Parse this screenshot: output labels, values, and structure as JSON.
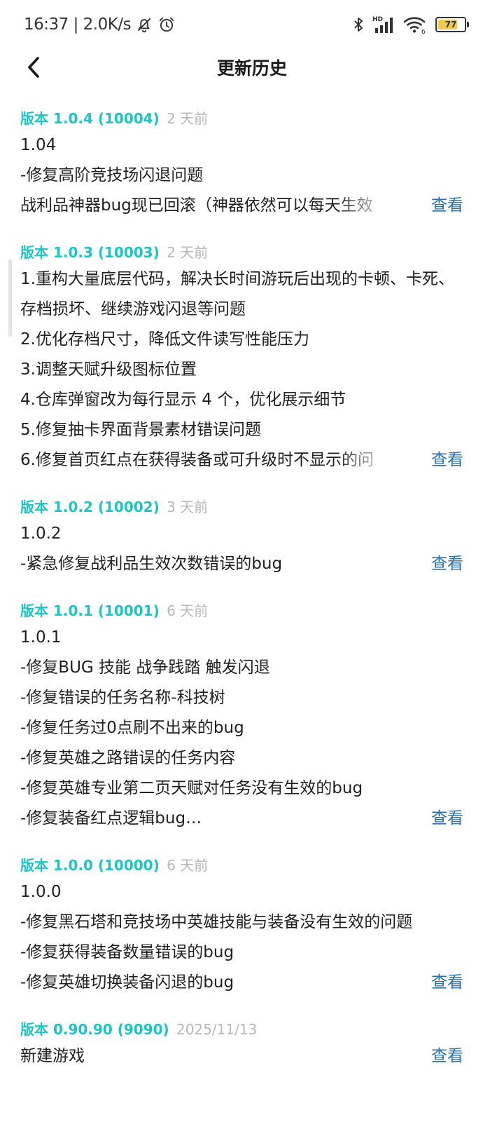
{
  "status_bar": {
    "time_speed": "16:37 | 2.0K/s",
    "battery": "77",
    "battery_level": 0.77,
    "wifi_badge": "6",
    "signal_badge": "HD"
  },
  "header": {
    "title": "更新历史"
  },
  "versions": [
    {
      "label": "版本 1.0.4 (10004)",
      "time": "2 天前",
      "lines": [
        "1.04",
        "-修复高阶竞技场闪退问题"
      ],
      "last_line": "战利品神器bug现已回滚（神器依然可以每天生效",
      "view_label": "查看"
    },
    {
      "label": "版本 1.0.3 (10003)",
      "time": "2 天前",
      "lines": [
        "1.重构大量底层代码，解决长时间游玩后出现的卡顿、卡死、存档损坏、继续游戏闪退等问题",
        "2.优化存档尺寸，降低文件读写性能压力",
        "3.调整天赋升级图标位置",
        "4.仓库弹窗改为每行显示 4 个，优化展示细节",
        "5.修复抽卡界面背景素材错误问题"
      ],
      "last_line": "6.修复首页红点在获得装备或可升级时不显示的问",
      "view_label": "查看"
    },
    {
      "label": "版本 1.0.2 (10002)",
      "time": "3 天前",
      "lines": [
        "1.0.2"
      ],
      "last_line": "-紧急修复战利品生效次数错误的bug",
      "view_label": "查看"
    },
    {
      "label": "版本 1.0.1 (10001)",
      "time": "6 天前",
      "lines": [
        "1.0.1",
        "-修复BUG 技能 战争践踏 触发闪退",
        "-修复错误的任务名称-科技树",
        "-修复任务过0点刷不出来的bug",
        "-修复英雄之路错误的任务内容",
        "-修复英雄专业第二页天赋对任务没有生效的bug"
      ],
      "last_line": "-修复装备红点逻辑bug…",
      "view_label": "查看"
    },
    {
      "label": "版本 1.0.0 (10000)",
      "time": "6 天前",
      "lines": [
        "1.0.0",
        "-修复黑石塔和竞技场中英雄技能与装备没有生效的问题",
        "-修复获得装备数量错误的bug"
      ],
      "last_line": "-修复英雄切换装备闪退的bug",
      "view_label": "查看"
    },
    {
      "label": "版本 0.90.90 (9090)",
      "time": "2025/11/13",
      "lines": [],
      "last_line": "新建游戏",
      "view_label": "查看"
    }
  ]
}
